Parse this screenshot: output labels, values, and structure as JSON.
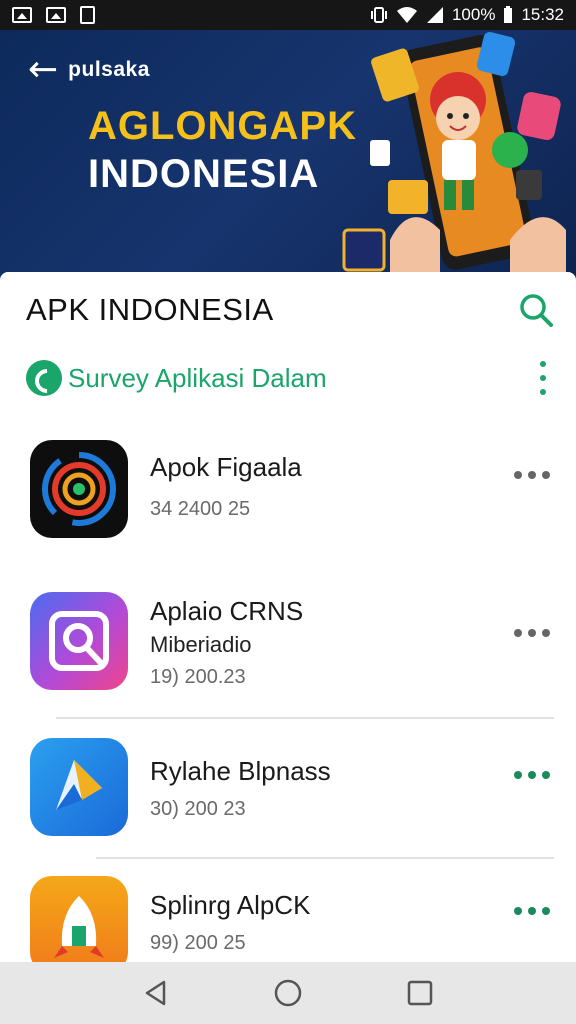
{
  "status_bar": {
    "battery": "100%",
    "time": "15:32"
  },
  "banner": {
    "brand": "pulsaka",
    "title_line1": "AGLONGAPK",
    "title_line2": "INDONESIA"
  },
  "header": {
    "title": "APK INDONESIA",
    "search_icon": "search-icon"
  },
  "subheader": {
    "label": "Survey Aplikasi Dalam"
  },
  "apps": [
    {
      "name": "Apok Figaala",
      "subtitle": "",
      "date": "34 2400 25",
      "icon": "target-icon",
      "dots_color": "#666666"
    },
    {
      "name": "Aplaio CRNS",
      "subtitle": "Miberiadio",
      "date": "19) 200.23",
      "icon": "photo-search-icon",
      "dots_color": "#666666"
    },
    {
      "name": "Rylahe Blpnass",
      "subtitle": "",
      "date": "30) 200 23",
      "icon": "paper-plane-icon",
      "dots_color": "#1a8a5c"
    },
    {
      "name": "Splinrg AlpCK",
      "subtitle": "",
      "date": "99) 200 25",
      "icon": "rocket-icon",
      "dots_color": "#1a8a5c"
    }
  ],
  "colors": {
    "accent": "#1aa56a",
    "banner_bg": "#0d2a5c",
    "banner_title": "#f5c01a"
  }
}
